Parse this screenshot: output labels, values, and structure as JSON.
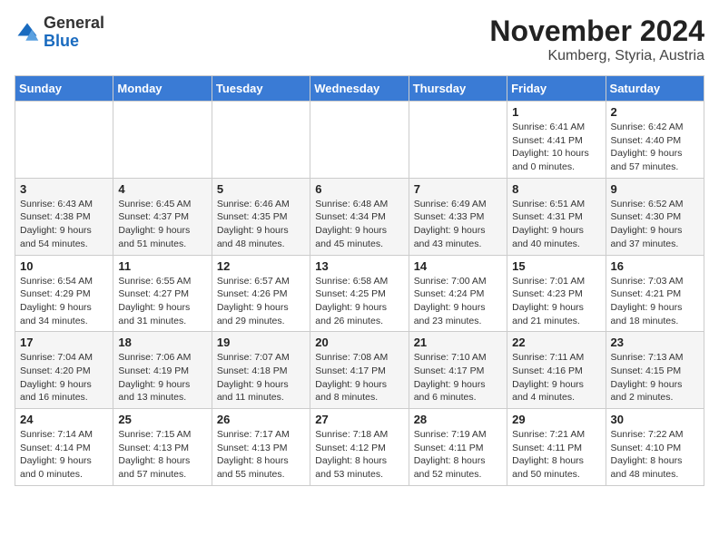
{
  "header": {
    "logo_general": "General",
    "logo_blue": "Blue",
    "month_title": "November 2024",
    "location": "Kumberg, Styria, Austria"
  },
  "days_of_week": [
    "Sunday",
    "Monday",
    "Tuesday",
    "Wednesday",
    "Thursday",
    "Friday",
    "Saturday"
  ],
  "weeks": [
    [
      {
        "day": "",
        "info": ""
      },
      {
        "day": "",
        "info": ""
      },
      {
        "day": "",
        "info": ""
      },
      {
        "day": "",
        "info": ""
      },
      {
        "day": "",
        "info": ""
      },
      {
        "day": "1",
        "info": "Sunrise: 6:41 AM\nSunset: 4:41 PM\nDaylight: 10 hours and 0 minutes."
      },
      {
        "day": "2",
        "info": "Sunrise: 6:42 AM\nSunset: 4:40 PM\nDaylight: 9 hours and 57 minutes."
      }
    ],
    [
      {
        "day": "3",
        "info": "Sunrise: 6:43 AM\nSunset: 4:38 PM\nDaylight: 9 hours and 54 minutes."
      },
      {
        "day": "4",
        "info": "Sunrise: 6:45 AM\nSunset: 4:37 PM\nDaylight: 9 hours and 51 minutes."
      },
      {
        "day": "5",
        "info": "Sunrise: 6:46 AM\nSunset: 4:35 PM\nDaylight: 9 hours and 48 minutes."
      },
      {
        "day": "6",
        "info": "Sunrise: 6:48 AM\nSunset: 4:34 PM\nDaylight: 9 hours and 45 minutes."
      },
      {
        "day": "7",
        "info": "Sunrise: 6:49 AM\nSunset: 4:33 PM\nDaylight: 9 hours and 43 minutes."
      },
      {
        "day": "8",
        "info": "Sunrise: 6:51 AM\nSunset: 4:31 PM\nDaylight: 9 hours and 40 minutes."
      },
      {
        "day": "9",
        "info": "Sunrise: 6:52 AM\nSunset: 4:30 PM\nDaylight: 9 hours and 37 minutes."
      }
    ],
    [
      {
        "day": "10",
        "info": "Sunrise: 6:54 AM\nSunset: 4:29 PM\nDaylight: 9 hours and 34 minutes."
      },
      {
        "day": "11",
        "info": "Sunrise: 6:55 AM\nSunset: 4:27 PM\nDaylight: 9 hours and 31 minutes."
      },
      {
        "day": "12",
        "info": "Sunrise: 6:57 AM\nSunset: 4:26 PM\nDaylight: 9 hours and 29 minutes."
      },
      {
        "day": "13",
        "info": "Sunrise: 6:58 AM\nSunset: 4:25 PM\nDaylight: 9 hours and 26 minutes."
      },
      {
        "day": "14",
        "info": "Sunrise: 7:00 AM\nSunset: 4:24 PM\nDaylight: 9 hours and 23 minutes."
      },
      {
        "day": "15",
        "info": "Sunrise: 7:01 AM\nSunset: 4:23 PM\nDaylight: 9 hours and 21 minutes."
      },
      {
        "day": "16",
        "info": "Sunrise: 7:03 AM\nSunset: 4:21 PM\nDaylight: 9 hours and 18 minutes."
      }
    ],
    [
      {
        "day": "17",
        "info": "Sunrise: 7:04 AM\nSunset: 4:20 PM\nDaylight: 9 hours and 16 minutes."
      },
      {
        "day": "18",
        "info": "Sunrise: 7:06 AM\nSunset: 4:19 PM\nDaylight: 9 hours and 13 minutes."
      },
      {
        "day": "19",
        "info": "Sunrise: 7:07 AM\nSunset: 4:18 PM\nDaylight: 9 hours and 11 minutes."
      },
      {
        "day": "20",
        "info": "Sunrise: 7:08 AM\nSunset: 4:17 PM\nDaylight: 9 hours and 8 minutes."
      },
      {
        "day": "21",
        "info": "Sunrise: 7:10 AM\nSunset: 4:17 PM\nDaylight: 9 hours and 6 minutes."
      },
      {
        "day": "22",
        "info": "Sunrise: 7:11 AM\nSunset: 4:16 PM\nDaylight: 9 hours and 4 minutes."
      },
      {
        "day": "23",
        "info": "Sunrise: 7:13 AM\nSunset: 4:15 PM\nDaylight: 9 hours and 2 minutes."
      }
    ],
    [
      {
        "day": "24",
        "info": "Sunrise: 7:14 AM\nSunset: 4:14 PM\nDaylight: 9 hours and 0 minutes."
      },
      {
        "day": "25",
        "info": "Sunrise: 7:15 AM\nSunset: 4:13 PM\nDaylight: 8 hours and 57 minutes."
      },
      {
        "day": "26",
        "info": "Sunrise: 7:17 AM\nSunset: 4:13 PM\nDaylight: 8 hours and 55 minutes."
      },
      {
        "day": "27",
        "info": "Sunrise: 7:18 AM\nSunset: 4:12 PM\nDaylight: 8 hours and 53 minutes."
      },
      {
        "day": "28",
        "info": "Sunrise: 7:19 AM\nSunset: 4:11 PM\nDaylight: 8 hours and 52 minutes."
      },
      {
        "day": "29",
        "info": "Sunrise: 7:21 AM\nSunset: 4:11 PM\nDaylight: 8 hours and 50 minutes."
      },
      {
        "day": "30",
        "info": "Sunrise: 7:22 AM\nSunset: 4:10 PM\nDaylight: 8 hours and 48 minutes."
      }
    ]
  ]
}
